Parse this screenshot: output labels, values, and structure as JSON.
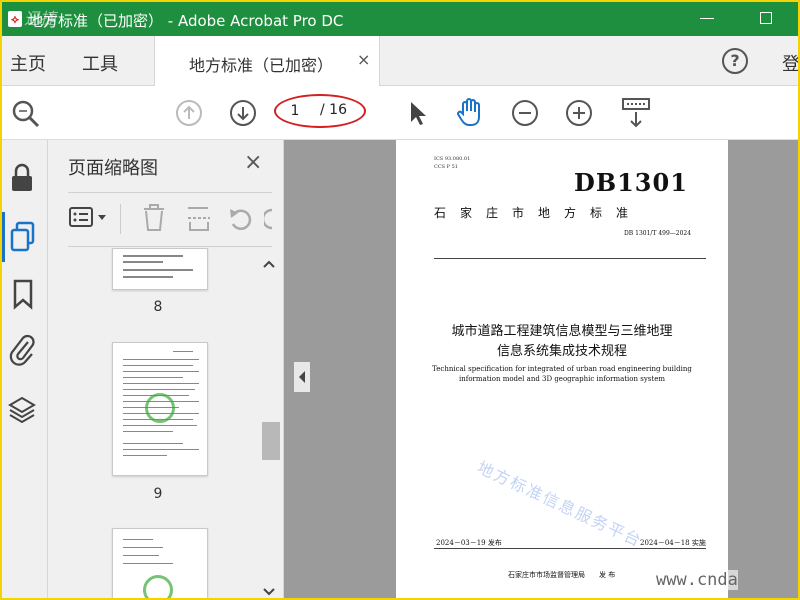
{
  "window": {
    "title": "地方标准（已加密） - Adobe Acrobat Pro DC",
    "watermark": "迅捷"
  },
  "menu": {
    "home": "主页",
    "tools": "工具",
    "tab_label": "地方标准（已加密）",
    "tab_close": "×",
    "help": "?",
    "login": "登"
  },
  "toolbar": {
    "current_page": "1",
    "total_pages": "/ 16"
  },
  "panel": {
    "title": "页面缩略图",
    "close": "×",
    "thumbnails": [
      {
        "page": "8"
      },
      {
        "page": "9"
      }
    ]
  },
  "document": {
    "ics": "ICS  93.080.01",
    "ccs": "CCS  P 51",
    "db_code": "DB1301",
    "org": "石家庄市地方标准",
    "std_no": "DB 1301/T 499—2024",
    "title_line1": "城市道路工程建筑信息模型与三维地理",
    "title_line2": "信息系统集成技术规程",
    "en_line1": "Technical specification for integrated of urban road engineering building",
    "en_line2": "information model and 3D geographic information system",
    "publish_date": "2024－03－19 发布",
    "effective_date": "2024－04－18 实施",
    "issuer": "石家庄市市场监督管理局　　发 布",
    "watermark": "地方标准信息服务平台"
  },
  "site_watermark": "www.cnda",
  "colors": {
    "titlebar": "#1e8f3e",
    "frame": "#f4d400",
    "accent": "#1a73c9",
    "annotation": "#d42020"
  }
}
